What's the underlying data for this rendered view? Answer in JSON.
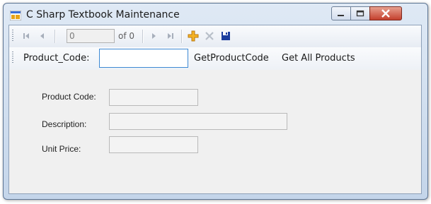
{
  "window": {
    "title": "C Sharp Textbook Maintenance"
  },
  "navigator": {
    "position_value": "0",
    "count_label": "of 0",
    "icons": [
      "move-first-icon",
      "move-previous-icon",
      "move-next-icon",
      "move-last-icon",
      "add-icon",
      "delete-icon",
      "save-icon"
    ]
  },
  "search": {
    "label": "Product_Code:",
    "value": "",
    "get_product_code": "GetProductCode",
    "get_all_products": "Get All Products"
  },
  "form": {
    "product_code_label": "Product Code:",
    "product_code_value": "",
    "description_label": "Description:",
    "description_value": "",
    "unit_price_label": "Unit Price:",
    "unit_price_value": ""
  },
  "colors": {
    "add_icon": "#f5b324",
    "save_icon": "#1b3e9e",
    "close_button": "#c4402d"
  }
}
